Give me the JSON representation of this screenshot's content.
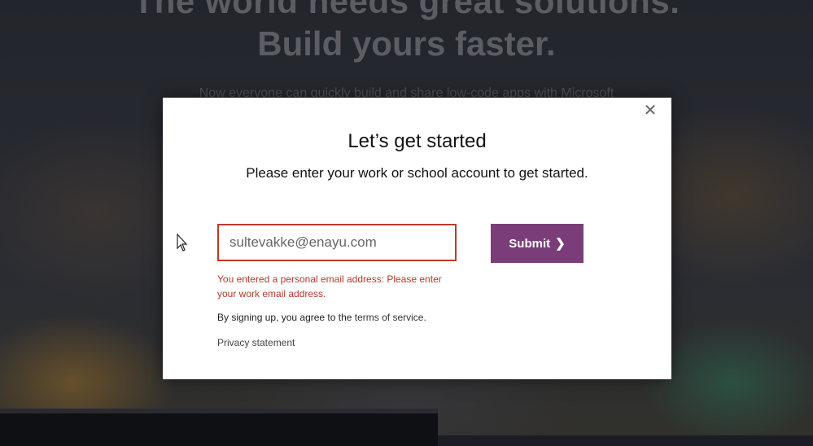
{
  "hero": {
    "line1": "The world needs great solutions.",
    "line2": "Build yours faster.",
    "subtitle": "Now everyone can quickly build and share low-code apps with Microsoft"
  },
  "modal": {
    "close_icon": "close-icon",
    "title": "Let’s get started",
    "subtitle": "Please enter your work or school account to get started.",
    "email": {
      "value": "sultevakke@enayu.com",
      "placeholder": ""
    },
    "submit_label": "Submit",
    "submit_icon": "chevron-right-icon",
    "error": "You entered a personal email address: Please enter your work email address.",
    "terms_prefix": "By signing up, you agree to the",
    "terms_link": "terms of service.",
    "privacy_link": "Privacy statement"
  },
  "colors": {
    "accent": "#7b3d7a",
    "error": "#b4392b"
  }
}
